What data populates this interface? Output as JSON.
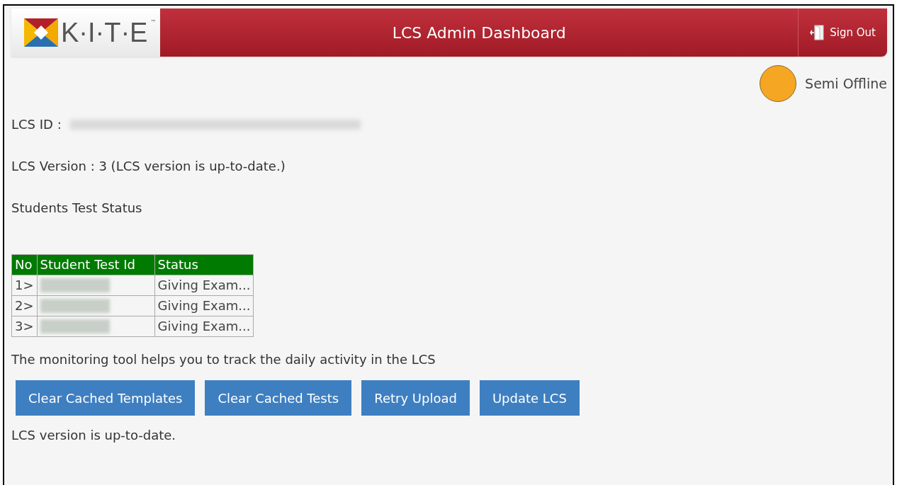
{
  "header": {
    "logo": "K·I·T·E",
    "trademark": "™",
    "title": "LCS Admin Dashboard",
    "sign_out": "Sign Out"
  },
  "status": {
    "label": "Semi Offline",
    "color": "#f5a623"
  },
  "lcs_id": {
    "label": "LCS ID :"
  },
  "lcs_version": "LCS Version : 3 (LCS version is up-to-date.)",
  "section_title": "Students Test Status",
  "table": {
    "columns": [
      "No",
      "Student Test Id",
      "Status"
    ],
    "rows": [
      {
        "no": "1>",
        "status": "Giving Exam..."
      },
      {
        "no": "2>",
        "status": "Giving Exam..."
      },
      {
        "no": "3>",
        "status": "Giving Exam..."
      }
    ]
  },
  "monitoring_note": "The monitoring tool helps you to track the daily activity in the LCS",
  "buttons": [
    "Clear Cached Templates",
    "Clear Cached Tests",
    "Retry Upload",
    "Update LCS"
  ],
  "footer_message": "LCS version is up-to-date."
}
